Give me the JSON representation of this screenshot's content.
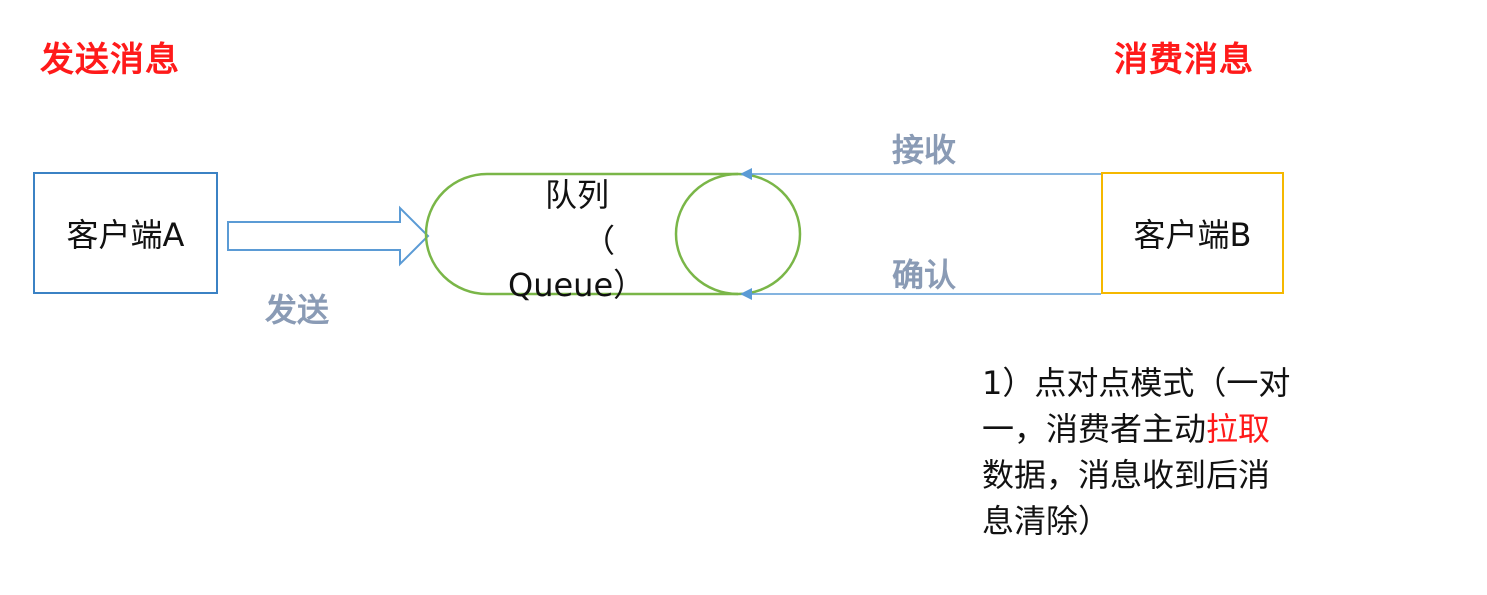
{
  "headings": {
    "send": "发送消息",
    "consume": "消费消息"
  },
  "nodes": {
    "client_a": "客户端A",
    "client_b": "客户端B",
    "queue_line1": "队列",
    "queue_line2": "（",
    "queue_line3": "Queue）"
  },
  "edges": {
    "send": "发送",
    "receive": "接收",
    "confirm": "确认"
  },
  "note": {
    "line1": "1）点对点模式（一对",
    "line2_prefix": "一，消费者主动",
    "line2_highlight": "拉取",
    "line3": "数据，消息收到后消",
    "line4": "息清除）"
  },
  "colors": {
    "heading": "#ff1a1a",
    "edge_label": "#8a9bb5",
    "client_a_border": "#3b82c4",
    "client_b_border": "#f5b800",
    "queue_stroke": "#7ab648",
    "arrow_stroke": "#5b9bd5",
    "highlight": "#ff1a1a"
  }
}
